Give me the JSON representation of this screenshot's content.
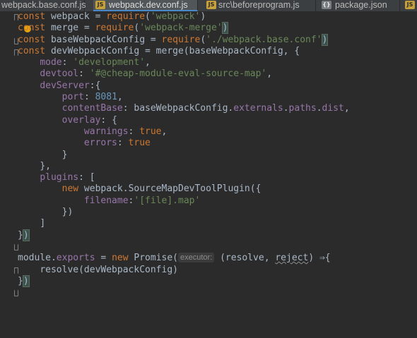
{
  "tabs": [
    {
      "label": "webpack.base.conf.js",
      "icon": "js-file-icon",
      "active": false
    },
    {
      "label": "webpack.dev.conf.js",
      "icon": "js-file-icon",
      "active": true
    },
    {
      "label": "src\\beforeprogram.js",
      "icon": "js-file-icon",
      "active": false
    },
    {
      "label": "package.json",
      "icon": "json-file-icon",
      "active": false
    },
    {
      "label": "",
      "icon": "js-file-icon",
      "active": false
    }
  ],
  "icon_text": {
    "js": "JS",
    "json": "{}"
  },
  "code": {
    "l1": {
      "kw": "const",
      "name": " webpack = ",
      "fn": "require",
      "open": "(",
      "str": "'webpack'",
      "close": ")"
    },
    "l2": {
      "kw": "const",
      "name": " merge = ",
      "fn": "require",
      "open": "(",
      "str": "'webpack-merge'",
      "close": ")"
    },
    "l3": {
      "kw": "const",
      "name": " baseWebpackConfig = ",
      "fn": "require",
      "open": "(",
      "str": "'./webpack.base.conf'",
      "close": ")"
    },
    "l4": {
      "kw": "const",
      "rest": " devWebpackConfig = merge(baseWebpackConfig, {"
    },
    "l5": {
      "prop": "mode",
      "colon": ": ",
      "str": "'development'",
      "comma": ","
    },
    "l6": {
      "prop": "devtool",
      "colon": ": ",
      "str": "'#@cheap-module-eval-source-map'",
      "comma": ","
    },
    "l7": {
      "prop": "devServer",
      "rest": ":{"
    },
    "l8": {
      "prop": "port",
      "colon": ": ",
      "num": "8081",
      "comma": ","
    },
    "l9": {
      "prop": "contentBase",
      "colon": ": ",
      "a": "baseWebpackConfig.",
      "p1": "externals",
      "dot": ".",
      "p2": "paths",
      "dot2": ".",
      "p3": "dist",
      "comma": ","
    },
    "l10": {
      "prop": "overlay",
      "rest": ": {"
    },
    "l11": {
      "prop": "warnings",
      "colon": ": ",
      "kw": "true",
      "comma": ","
    },
    "l12": {
      "prop": "errors",
      "colon": ": ",
      "kw": "true"
    },
    "l13": {
      "text": "}"
    },
    "l14": {
      "text": "},"
    },
    "l15": {
      "prop": "plugins",
      "rest": ": ["
    },
    "l16": {
      "kw": "new",
      "rest": " webpack.",
      "cls": "SourceMapDevToolPlugin",
      "end": "({"
    },
    "l17": {
      "prop": "filename",
      "colon": ":",
      "str": "'[file].map'"
    },
    "l18": {
      "text": "})"
    },
    "l19": {
      "text": "]"
    },
    "l20": {
      "a": "}",
      "b": ")"
    },
    "l22": {
      "a": "module.",
      "prop": "exports",
      "b": " = ",
      "kw": "new",
      "c": " Promise(",
      "hint": "executor:",
      "d": " (resolve, ",
      "e": "reject",
      "f": ") ⇒{"
    },
    "l23": {
      "text": "resolve(devWebpackConfig)"
    },
    "l24": {
      "a": "}",
      "b": ")"
    }
  }
}
